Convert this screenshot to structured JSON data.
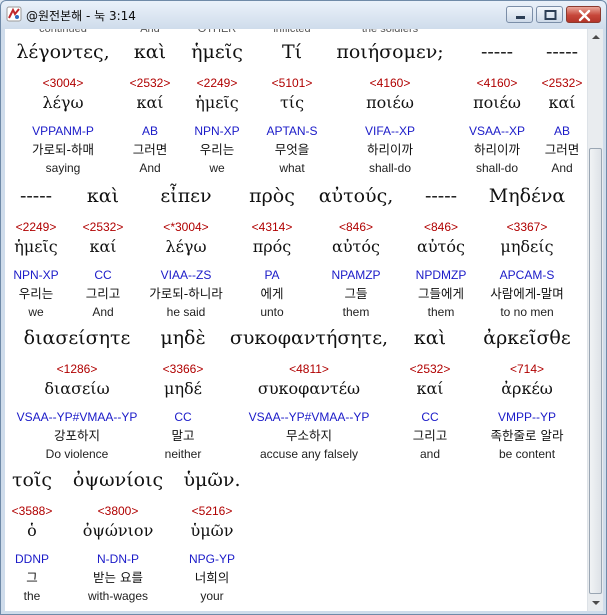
{
  "window": {
    "title": "@원전본해 - 눅 3:14"
  },
  "colors": {
    "strongs": "#b00000",
    "morph": "#1a1ac8"
  },
  "cutoff": [
    "continued",
    "And",
    "OTHER",
    "inflicted",
    "the soldiers"
  ],
  "rows": [
    {
      "words": [
        {
          "greek": "λέγοντες,",
          "strong": "<3004>",
          "lemma": "λέγω",
          "morph": "VPPANM-P",
          "korean": "가로되-하매",
          "english": "saying"
        },
        {
          "greek": "καὶ",
          "strong": "<2532>",
          "lemma": "καί",
          "morph": "AB",
          "korean": "그러면",
          "english": "And"
        },
        {
          "greek": "ἡμεῖς",
          "strong": "<2249>",
          "lemma": "ἡμεῖς",
          "morph": "NPN-XP",
          "korean": "우리는",
          "english": "we"
        },
        {
          "greek": "Τί",
          "strong": "<5101>",
          "lemma": "τίς",
          "morph": "APTAN-S",
          "korean": "무엇을",
          "english": "what"
        },
        {
          "greek": "ποιήσομεν;",
          "strong": "<4160>",
          "lemma": "ποιέω",
          "morph": "VIFA--XP",
          "korean": "하리이까",
          "english": "shall-do"
        },
        {
          "greek": "-----",
          "strong": "<4160>",
          "lemma": "ποιέω",
          "morph": "VSAA--XP",
          "korean": "하리이까",
          "english": "shall-do"
        },
        {
          "greek": "-----",
          "strong": "<2532>",
          "lemma": "καί",
          "morph": "AB",
          "korean": "그러면",
          "english": "And"
        }
      ]
    },
    {
      "words": [
        {
          "greek": "-----",
          "strong": "<2249>",
          "lemma": "ἡμεῖς",
          "morph": "NPN-XP",
          "korean": "우리는",
          "english": "we"
        },
        {
          "greek": "καὶ",
          "strong": "<2532>",
          "lemma": "καί",
          "morph": "CC",
          "korean": "그리고",
          "english": "And"
        },
        {
          "greek": "εἶπεν",
          "strong": "<*3004>",
          "lemma": "λέγω",
          "morph": "VIAA--ZS",
          "korean": "가로되-하니라",
          "english": "he said"
        },
        {
          "greek": "πρὸς",
          "strong": "<4314>",
          "lemma": "πρός",
          "morph": "PA",
          "korean": "에게",
          "english": "unto"
        },
        {
          "greek": "αὐτούς,",
          "strong": "<846>",
          "lemma": "αὐτός",
          "morph": "NPAMZP",
          "korean": "그들",
          "english": "them"
        },
        {
          "greek": "-----",
          "strong": "<846>",
          "lemma": "αὐτός",
          "morph": "NPDMZP",
          "korean": "그들에게",
          "english": "them"
        },
        {
          "greek": "Μηδένα",
          "strong": "<3367>",
          "lemma": "μηδείς",
          "morph": "APCAM-S",
          "korean": "사람에게-말며",
          "english": "to no men"
        }
      ]
    },
    {
      "words": [
        {
          "greek": "διασείσητε",
          "strong": "<1286>",
          "lemma": "διασείω",
          "morph": "VSAA--YP#VMAA--YP",
          "korean": "강포하지",
          "english": "Do violence"
        },
        {
          "greek": "μηδὲ",
          "strong": "<3366>",
          "lemma": "μηδέ",
          "morph": "CC",
          "korean": "말고",
          "english": "neither"
        },
        {
          "greek": "συκοφαντήσητε,",
          "strong": "<4811>",
          "lemma": "συκοφαντέω",
          "morph": "VSAA--YP#VMAA--YP",
          "korean": "무소하지",
          "english": "accuse any falsely"
        },
        {
          "greek": "καὶ",
          "strong": "<2532>",
          "lemma": "καί",
          "morph": "CC",
          "korean": "그리고",
          "english": "and"
        },
        {
          "greek": "ἀρκεῖσθε",
          "strong": "<714>",
          "lemma": "ἀρκέω",
          "morph": "VMPP--YP",
          "korean": "족한줄로 알라",
          "english": "be content"
        }
      ]
    },
    {
      "words": [
        {
          "greek": "τοῖς",
          "strong": "<3588>",
          "lemma": "ὁ",
          "morph": "DDNP",
          "korean": "그",
          "english": "the"
        },
        {
          "greek": "ὀψωνίοις",
          "strong": "<3800>",
          "lemma": "ὀψώνιον",
          "morph": "N-DN-P",
          "korean": "받는 요를",
          "english": "with-wages"
        },
        {
          "greek": "ὑμῶν.",
          "strong": "<5216>",
          "lemma": "ὑμῶν",
          "morph": "NPG-YP",
          "korean": "너희의",
          "english": "your"
        }
      ]
    }
  ]
}
